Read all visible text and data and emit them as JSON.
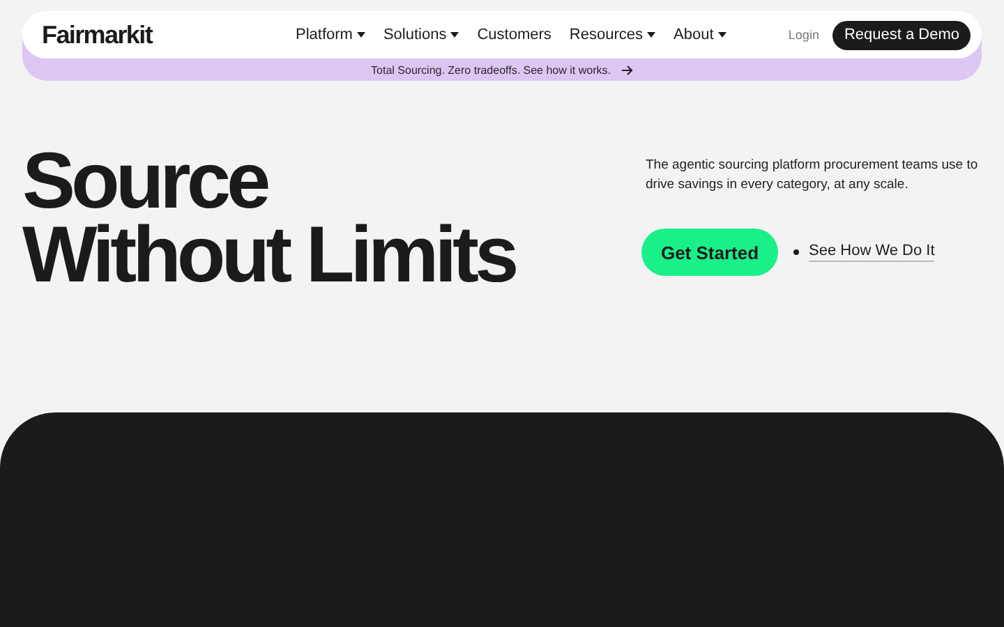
{
  "logo": "Fairmarkit",
  "nav": [
    {
      "label": "Platform",
      "has_menu": true
    },
    {
      "label": "Solutions",
      "has_menu": true
    },
    {
      "label": "Customers",
      "has_menu": false
    },
    {
      "label": "Resources",
      "has_menu": true
    },
    {
      "label": "About",
      "has_menu": true
    }
  ],
  "login": "Login",
  "demo_button": "Request a Demo",
  "banner": "Total Sourcing. Zero tradeoffs. See how it works.",
  "hero": {
    "title_lines": [
      "Source",
      "Without Limits"
    ],
    "description": "The agentic sourcing platform procurement teams use to drive savings in every category, at any scale.",
    "primary_button": "Get Started",
    "secondary_link": "See How We Do It"
  }
}
